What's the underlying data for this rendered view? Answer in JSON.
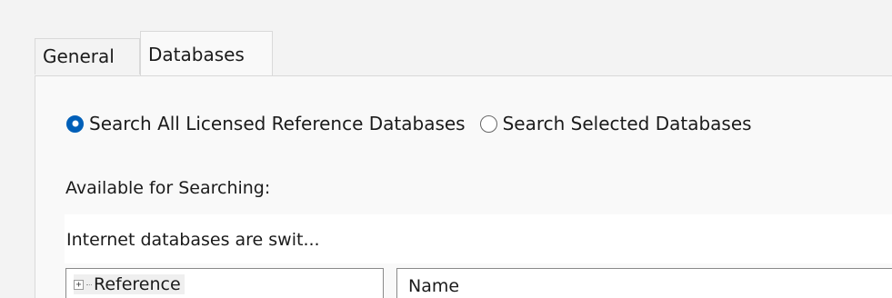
{
  "tabs": [
    {
      "label": "General",
      "active": false
    },
    {
      "label": "Databases",
      "active": true
    }
  ],
  "search_options": {
    "all_licensed": {
      "label": "Search All Licensed Reference Databases",
      "selected": true
    },
    "selected": {
      "label": "Search Selected Databases",
      "selected": false
    }
  },
  "available_label": "Available for Searching:",
  "info_text": "Internet databases are swit...",
  "tree": {
    "items": [
      {
        "label": "Reference",
        "expander": "+"
      }
    ]
  },
  "list": {
    "columns": [
      "Name"
    ]
  },
  "colors": {
    "accent": "#005fb8",
    "background": "#f3f3f3",
    "panel": "#f9f9f9"
  }
}
